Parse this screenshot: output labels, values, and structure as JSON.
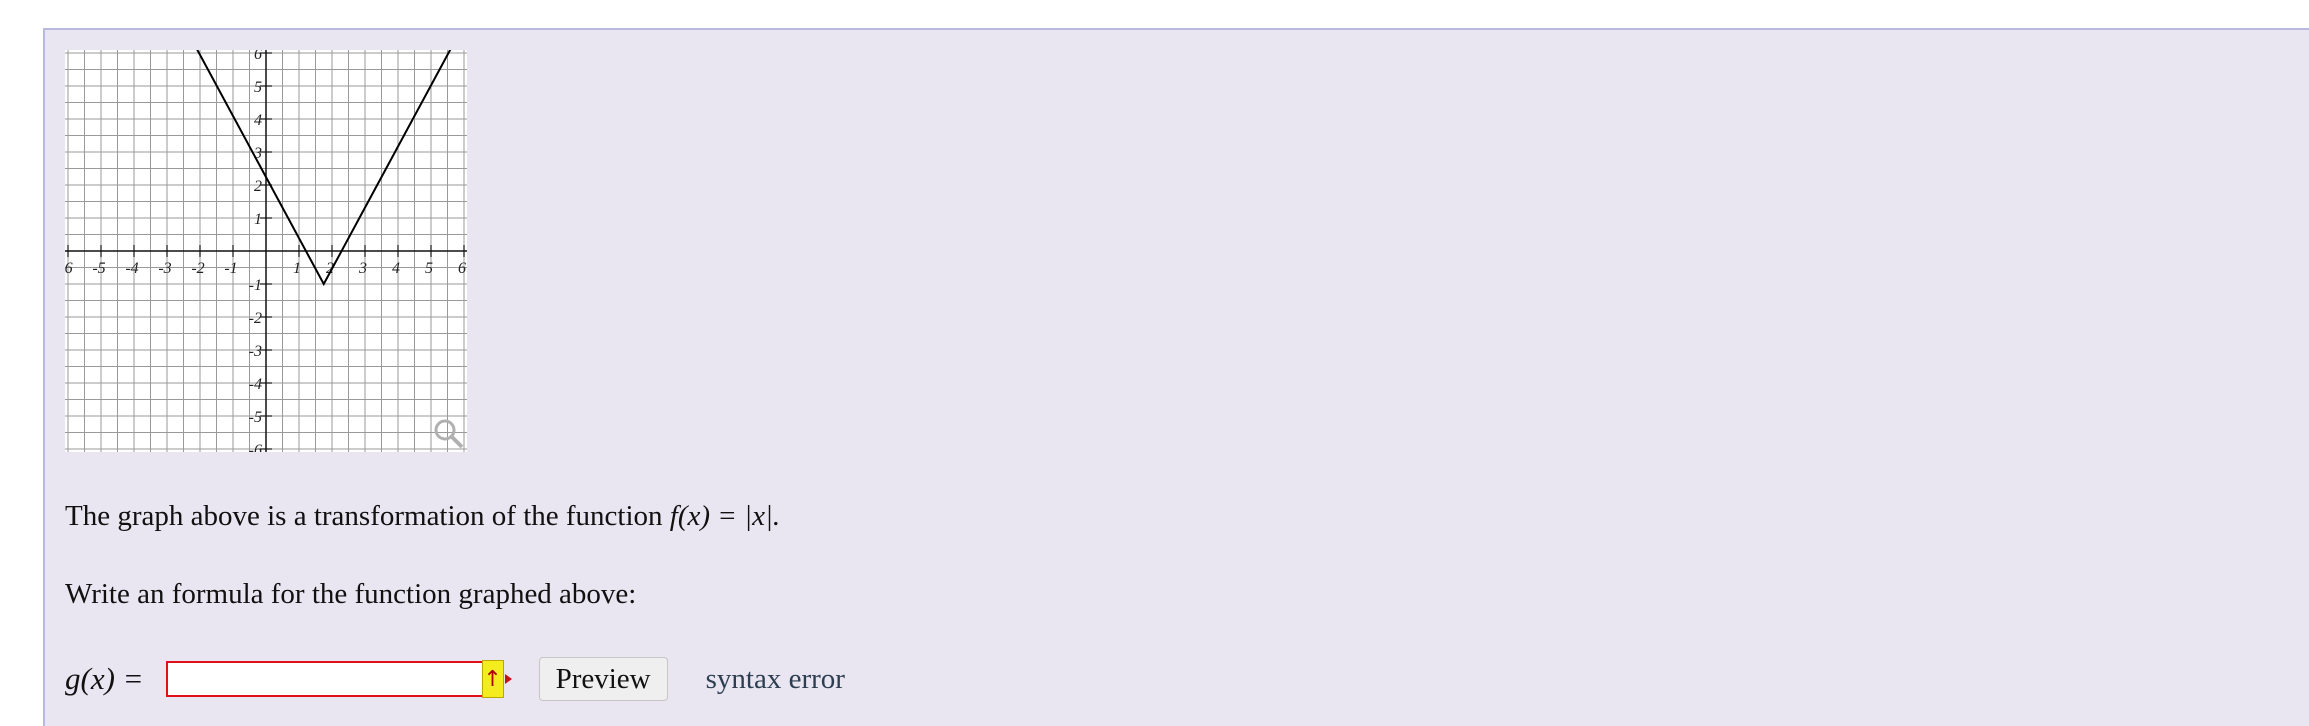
{
  "question": {
    "statement_prefix": "The graph above is a transformation of the function",
    "statement_math": "f(x) = |x|.",
    "prompt": "Write an formula for the function graphed above:",
    "answer_label": "g(x) =",
    "answer_value": "",
    "preview_label": "Preview",
    "status": "syntax error"
  },
  "icons": {
    "keyboard_icon": "↑",
    "magnify": "magnifier-icon"
  },
  "colors": {
    "panel_background": "#e9e5f1",
    "input_error_border": "#e0101a",
    "keyboard_button": "#f4ec1d"
  },
  "chart_data": {
    "type": "line",
    "xlim": [
      -6,
      6
    ],
    "ylim": [
      -6,
      6
    ],
    "grid": true,
    "x_ticks": [
      "-6",
      "-5",
      "-4",
      "-3",
      "-2",
      "-1",
      "1",
      "2",
      "3",
      "4",
      "5",
      "6"
    ],
    "y_ticks": [
      "6",
      "5",
      "4",
      "3",
      "2",
      "1",
      "-1",
      "-2",
      "-3",
      "-4",
      "-5",
      "-6"
    ],
    "series": [
      {
        "points": [
          [
            -2.3,
            6.5
          ],
          [
            1.75,
            -1
          ],
          [
            5.8,
            6.5
          ]
        ]
      }
    ]
  }
}
